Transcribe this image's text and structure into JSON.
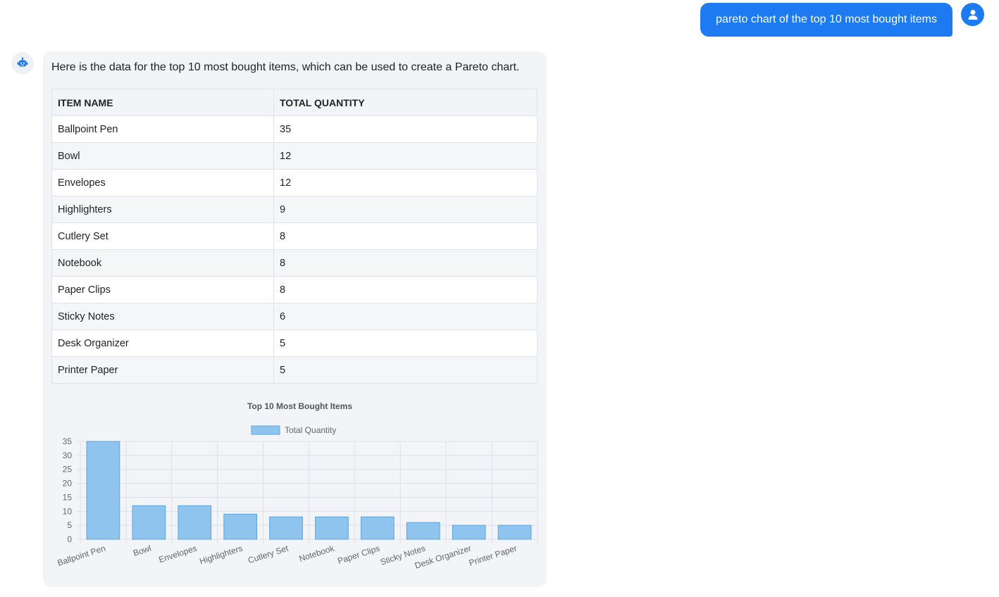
{
  "user_message": {
    "text": "pareto chart of the top 10 most bought items"
  },
  "bot_message": {
    "intro": "Here is the data for the top 10 most bought items, which can be used to create a Pareto chart.",
    "table": {
      "headers": [
        "ITEM NAME",
        "TOTAL QUANTITY"
      ],
      "rows": [
        [
          "Ballpoint Pen",
          "35"
        ],
        [
          "Bowl",
          "12"
        ],
        [
          "Envelopes",
          "12"
        ],
        [
          "Highlighters",
          "9"
        ],
        [
          "Cutlery Set",
          "8"
        ],
        [
          "Notebook",
          "8"
        ],
        [
          "Paper Clips",
          "8"
        ],
        [
          "Sticky Notes",
          "6"
        ],
        [
          "Desk Organizer",
          "5"
        ],
        [
          "Printer Paper",
          "5"
        ]
      ]
    }
  },
  "colors": {
    "accent": "#1e7af0",
    "bar_fill": "#8ec4ee",
    "bar_stroke": "#5aa6e0"
  },
  "icons": {
    "user": "user-icon",
    "bot": "robot-icon"
  },
  "chart_data": {
    "type": "bar",
    "title": "Top 10 Most Bought Items",
    "categories": [
      "Ballpoint Pen",
      "Bowl",
      "Envelopes",
      "Highlighters",
      "Cutlery Set",
      "Notebook",
      "Paper Clips",
      "Sticky Notes",
      "Desk Organizer",
      "Printer Paper"
    ],
    "series": [
      {
        "name": "Total Quantity",
        "values": [
          35,
          12,
          12,
          9,
          8,
          8,
          8,
          6,
          5,
          5
        ]
      }
    ],
    "ylim": [
      0,
      35
    ],
    "yticks": [
      0,
      5,
      10,
      15,
      20,
      25,
      30,
      35
    ],
    "xlabel": "",
    "ylabel": "",
    "grid": true,
    "legend": "top-center"
  }
}
